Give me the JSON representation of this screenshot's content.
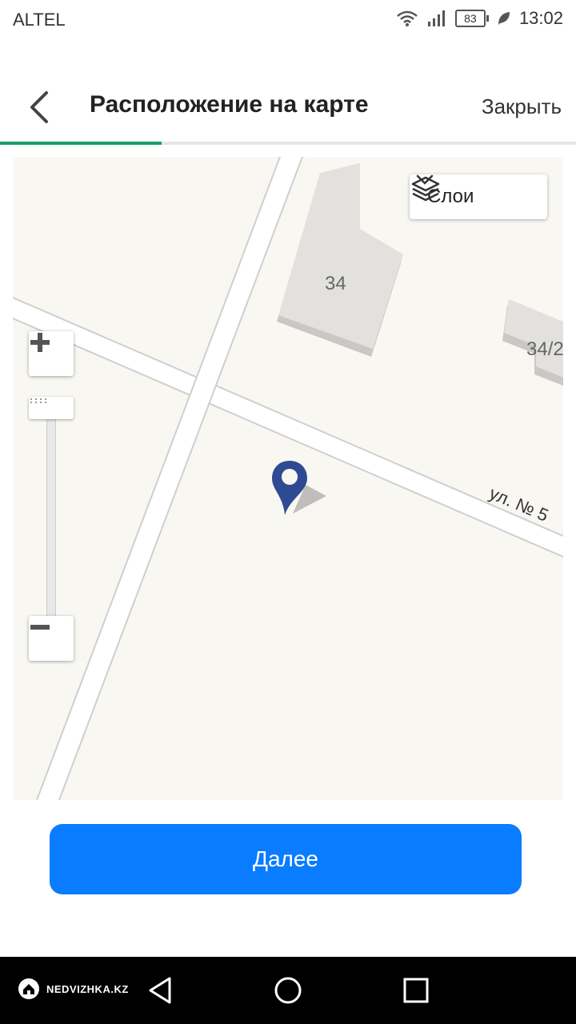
{
  "status_bar": {
    "carrier": "ALTEL",
    "battery_level": "83",
    "time": "13:02"
  },
  "header": {
    "title": "Расположение на карте",
    "close_label": "Закрыть",
    "progress_percent": 28
  },
  "map": {
    "layers_label": "Слои",
    "street_label": "ул. № 5",
    "building_labels": [
      "34",
      "34/2"
    ]
  },
  "actions": {
    "next_label": "Далее"
  },
  "nav_bar": {
    "brand": "NEDVIZHKA.KZ"
  },
  "colors": {
    "accent": "#0a7cff",
    "progress": "#1e9e6a",
    "pin": "#2f4a93",
    "map_bg": "#f8f7f2"
  }
}
